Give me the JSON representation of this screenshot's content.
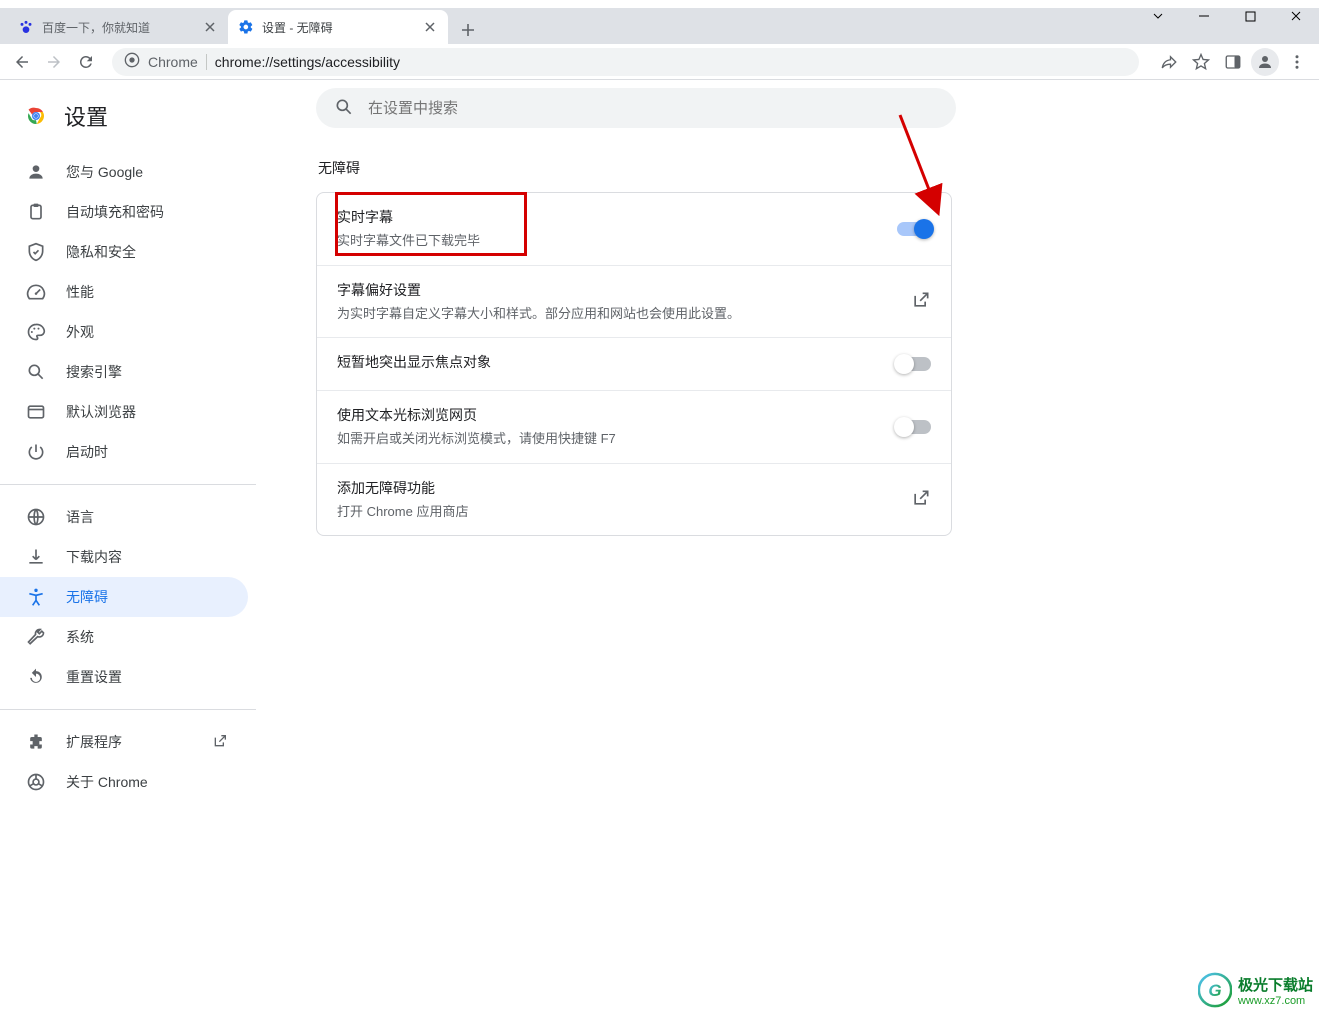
{
  "tabs": [
    {
      "title": "百度一下，你就知道",
      "favicon": "baidu"
    },
    {
      "title": "设置 - 无障碍",
      "favicon": "gear"
    }
  ],
  "omnibox": {
    "scheme_label": "Chrome",
    "url_path": "chrome://settings/accessibility"
  },
  "sidebar": {
    "title": "设置",
    "items": [
      {
        "label": "您与 Google",
        "icon": "person"
      },
      {
        "label": "自动填充和密码",
        "icon": "clipboard"
      },
      {
        "label": "隐私和安全",
        "icon": "shield"
      },
      {
        "label": "性能",
        "icon": "speed"
      },
      {
        "label": "外观",
        "icon": "palette"
      },
      {
        "label": "搜索引擎",
        "icon": "search"
      },
      {
        "label": "默认浏览器",
        "icon": "browser"
      },
      {
        "label": "启动时",
        "icon": "power"
      }
    ],
    "items2": [
      {
        "label": "语言",
        "icon": "globe"
      },
      {
        "label": "下载内容",
        "icon": "download"
      },
      {
        "label": "无障碍",
        "icon": "accessibility",
        "active": true
      },
      {
        "label": "系统",
        "icon": "wrench"
      },
      {
        "label": "重置设置",
        "icon": "restore"
      }
    ],
    "items3": [
      {
        "label": "扩展程序",
        "icon": "extension",
        "external": true
      },
      {
        "label": "关于 Chrome",
        "icon": "chrome"
      }
    ]
  },
  "search": {
    "placeholder": "在设置中搜索"
  },
  "section": {
    "title": "无障碍"
  },
  "rows": {
    "live_caption": {
      "title": "实时字幕",
      "sub": "实时字幕文件已下载完毕",
      "toggle": true
    },
    "caption_pref": {
      "title": "字幕偏好设置",
      "sub": "为实时字幕自定义字幕大小和样式。部分应用和网站也会使用此设置。"
    },
    "focus_highlight": {
      "title": "短暂地突出显示焦点对象",
      "toggle": false
    },
    "caret_browsing": {
      "title": "使用文本光标浏览网页",
      "sub": "如需开启或关闭光标浏览模式，请使用快捷键 F7",
      "toggle": false
    },
    "add_a11y": {
      "title": "添加无障碍功能",
      "sub": "打开 Chrome 应用商店"
    }
  },
  "watermark": {
    "line1": "极光下载站",
    "line2": "www.xz7.com"
  }
}
